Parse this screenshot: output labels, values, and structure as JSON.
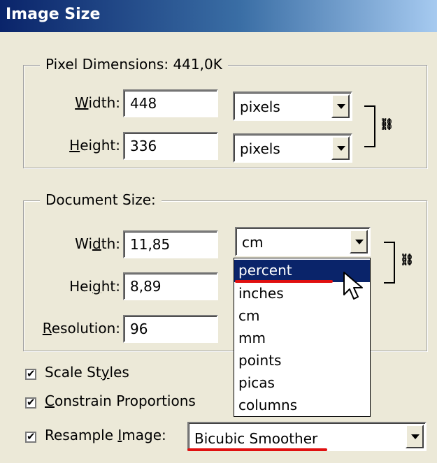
{
  "window": {
    "title": "Image Size"
  },
  "pixel_dimensions": {
    "legend": "Pixel Dimensions:",
    "size": "441,0K",
    "width_label": "Width:",
    "width_value": "448",
    "width_unit": "pixels",
    "height_label": "Height:",
    "height_value": "336",
    "height_unit": "pixels"
  },
  "document_size": {
    "legend": "Document Size:",
    "width_label": "Width:",
    "width_value": "11,85",
    "width_unit": "cm",
    "height_label": "Height:",
    "height_value": "8,89",
    "resolution_label": "Resolution:",
    "resolution_value": "96"
  },
  "unit_dropdown": {
    "options": [
      "percent",
      "inches",
      "cm",
      "mm",
      "points",
      "picas",
      "columns"
    ],
    "highlighted": "percent"
  },
  "options": {
    "scale_styles": {
      "label": "Scale Styles",
      "checked": true
    },
    "constrain_proportions": {
      "label": "Constrain Proportions",
      "checked": true
    },
    "resample_image": {
      "label": "Resample Image:",
      "checked": true,
      "value": "Bicubic Smoother"
    }
  },
  "icons": {
    "link": "chain-link-icon",
    "cursor": "arrow-cursor-icon"
  },
  "colors": {
    "selection": "#0a246a",
    "annotation": "#e01010",
    "dialog_bg": "#ece9d8"
  }
}
